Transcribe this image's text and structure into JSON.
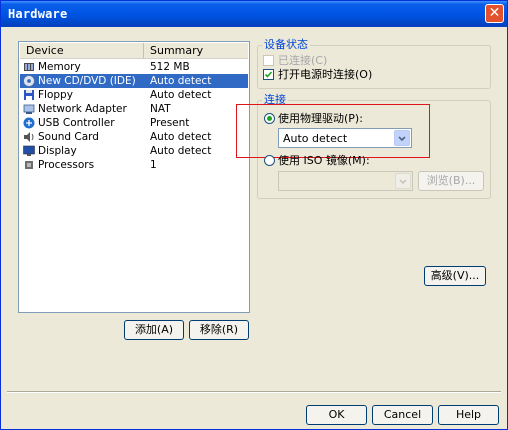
{
  "window": {
    "title": "Hardware",
    "close_glyph": "✕"
  },
  "device_list": {
    "columns": [
      "Device",
      "Summary"
    ],
    "rows": [
      {
        "name": "Memory",
        "summary": "512 MB",
        "icon": "memory-icon"
      },
      {
        "name": "New CD/DVD (IDE)",
        "summary": "Auto detect",
        "icon": "cd-dvd-icon",
        "selected": true
      },
      {
        "name": "Floppy",
        "summary": "Auto detect",
        "icon": "floppy-icon"
      },
      {
        "name": "Network Adapter",
        "summary": "NAT",
        "icon": "network-adapter-icon"
      },
      {
        "name": "USB Controller",
        "summary": "Present",
        "icon": "usb-icon"
      },
      {
        "name": "Sound Card",
        "summary": "Auto detect",
        "icon": "sound-card-icon"
      },
      {
        "name": "Display",
        "summary": "Auto detect",
        "icon": "display-icon"
      },
      {
        "name": "Processors",
        "summary": "1",
        "icon": "processor-icon"
      }
    ],
    "add_label": "添加(A)",
    "remove_label": "移除(R)"
  },
  "device_status": {
    "group_label": "设备状态",
    "connected_label": "已连接(C)",
    "connected_checked": false,
    "power_on_label": "打开电源时连接(O)",
    "power_on_checked": true
  },
  "connection": {
    "group_label": "连接",
    "physical_label": "使用物理驱动(P):",
    "physical_selected": true,
    "physical_value": "Auto detect",
    "iso_label": "使用 ISO 镜像(M):",
    "iso_selected": false,
    "iso_value": "",
    "browse_label": "浏览(B)...",
    "advanced_label": "高级(V)..."
  },
  "footer": {
    "ok": "OK",
    "cancel": "Cancel",
    "help": "Help"
  },
  "colors": {
    "title_bar": "#0055e5",
    "selection": "#316ac5",
    "group_label": "#0046d5",
    "highlight_box": "#e0141a"
  }
}
